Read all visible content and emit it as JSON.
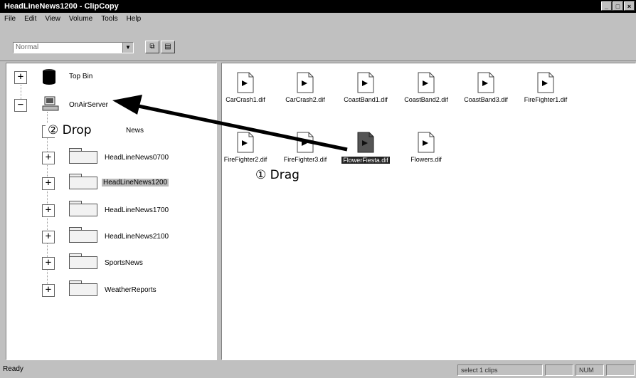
{
  "window": {
    "title": "HeadLineNews1200 - ClipCopy",
    "controls": [
      "_",
      "□",
      "×"
    ]
  },
  "menu": [
    "File",
    "Edit",
    "View",
    "Volume",
    "Tools",
    "Help"
  ],
  "toolbar": {
    "combo_value": "Normal"
  },
  "tree": {
    "nodes": [
      {
        "label": "Top Bin",
        "expander": "+",
        "icon": "bin-icon"
      },
      {
        "label": "OnAirServer",
        "expander": "−",
        "icon": "server-icon"
      },
      {
        "label": "News",
        "expander": "+",
        "icon": "folder-icon"
      },
      {
        "label": "HeadLineNews0700",
        "expander": "+",
        "icon": "folder-icon"
      },
      {
        "label": "HeadLineNews1200",
        "expander": "+",
        "icon": "folder-icon",
        "selected": true
      },
      {
        "label": "HeadLineNews1700",
        "expander": "+",
        "icon": "folder-icon"
      },
      {
        "label": "HeadLineNews2100",
        "expander": "+",
        "icon": "folder-icon"
      },
      {
        "label": "SportsNews",
        "expander": "+",
        "icon": "folder-icon"
      },
      {
        "label": "WeatherReports",
        "expander": "+",
        "icon": "folder-icon"
      }
    ]
  },
  "files": [
    {
      "name": "CarCrash1.dif"
    },
    {
      "name": "CarCrash2.dif"
    },
    {
      "name": "CoastBand1.dif"
    },
    {
      "name": "CoastBand2.dif"
    },
    {
      "name": "CoastBand3.dif"
    },
    {
      "name": "FireFighter1.dif"
    },
    {
      "name": "FireFighter2.dif"
    },
    {
      "name": "FireFighter3.dif"
    },
    {
      "name": "FlowerFiesta.dif",
      "selected": true
    },
    {
      "name": "Flowers.dif"
    }
  ],
  "annotations": {
    "drop": "② Drop",
    "drag": "① Drag"
  },
  "status": {
    "ready": "Ready",
    "selection": "select 1 clips",
    "num": "NUM"
  }
}
